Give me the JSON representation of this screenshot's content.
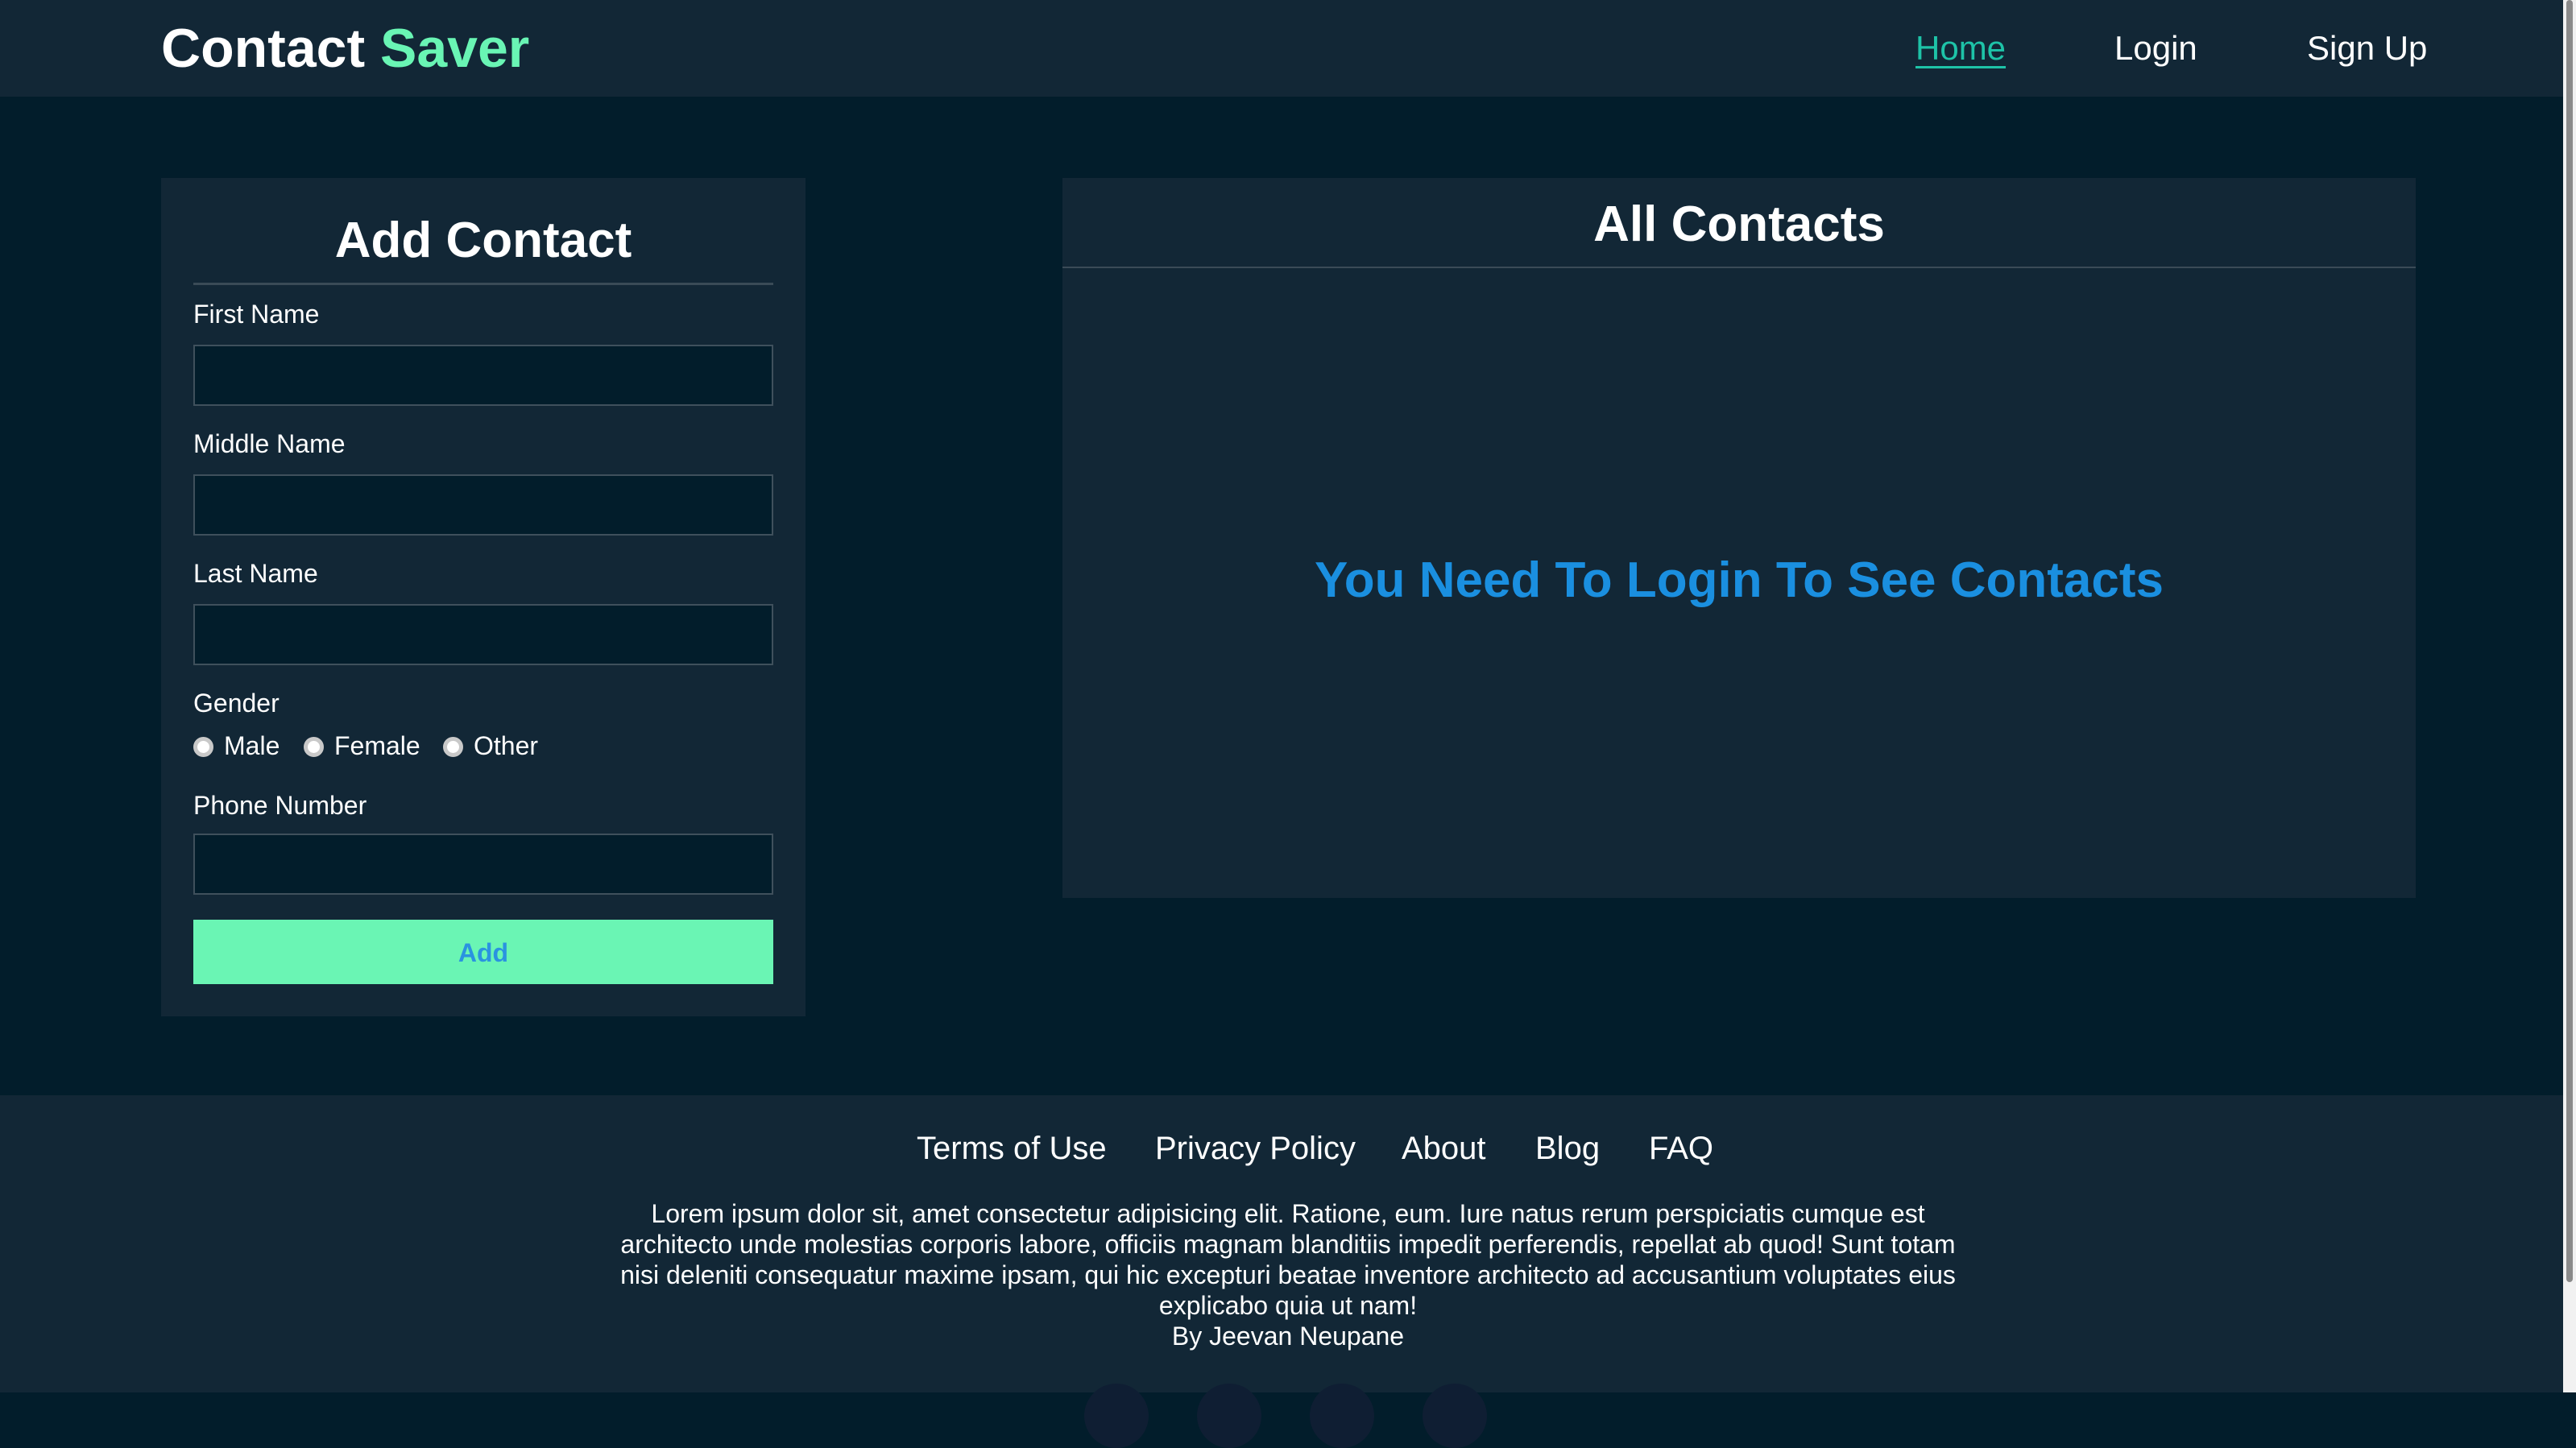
{
  "header": {
    "logo_main": "Contact ",
    "logo_accent": "Saver",
    "nav": {
      "home": "Home",
      "login": "Login",
      "signup": "Sign Up"
    }
  },
  "form": {
    "title": "Add Contact",
    "first_name_label": "First Name",
    "first_name_value": "",
    "middle_name_label": "Middle Name",
    "middle_name_value": "",
    "last_name_label": "Last Name",
    "last_name_value": "",
    "gender_label": "Gender",
    "gender_options": [
      "Male",
      "Female",
      "Other"
    ],
    "phone_label": "Phone Number",
    "phone_value": "",
    "add_button": "Add"
  },
  "contacts": {
    "title": "All Contacts",
    "message": "You Need To Login To See Contacts"
  },
  "footer": {
    "links": [
      "Terms of Use",
      "Privacy Policy",
      "About",
      "Blog",
      "FAQ"
    ],
    "text": "Lorem ipsum dolor sit, amet consectetur adipisicing elit. Ratione, eum. Iure natus rerum perspiciatis cumque est architecto unde molestias corporis labore, officiis magnam blanditiis impedit perferendis, repellat ab quod! Sunt totam nisi deleniti consequatur maxime ipsam, qui hic excepturi beatae inventore architecto ad accusantium voluptates eius explicabo quia ut nam!",
    "author": "By Jeevan Neupane"
  },
  "colors": {
    "background": "#021d2b",
    "panel": "#122736",
    "accent_green": "#69f5b4",
    "accent_blue": "#1a8fe0",
    "active_link": "#1ec3a8"
  }
}
